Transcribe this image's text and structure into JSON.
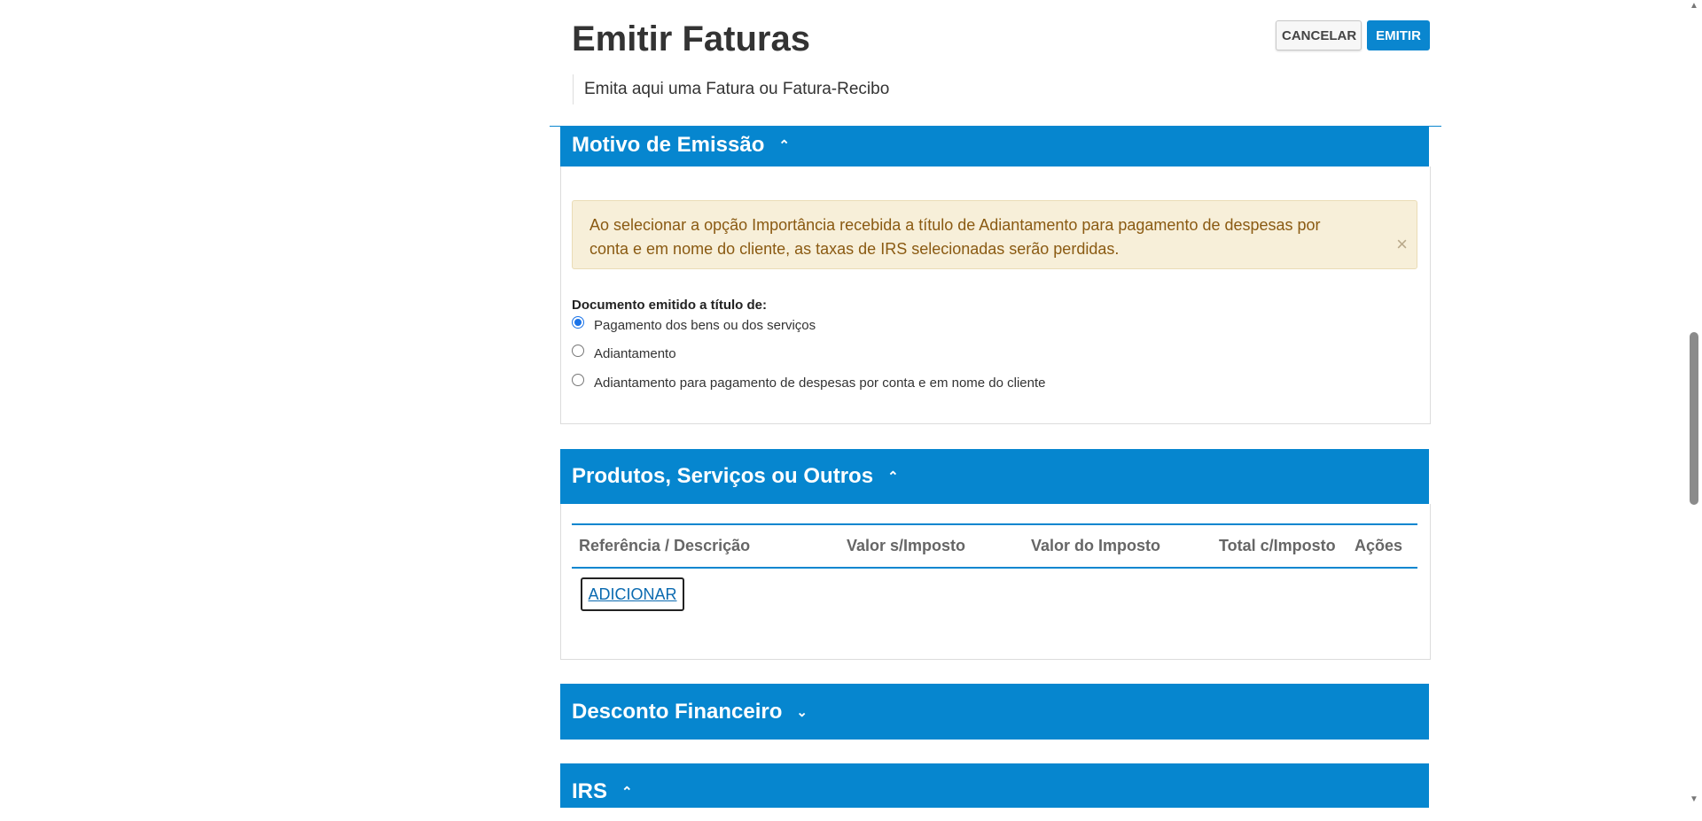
{
  "header": {
    "title": "Emitir Faturas",
    "subtitle": "Emita aqui uma Fatura ou Fatura-Recibo",
    "cancel_label": "CANCELAR",
    "emit_label": "EMITIR"
  },
  "motivo": {
    "title": "Motivo de Emissão",
    "alert_text": "Ao selecionar a opção Importância recebida a título de Adiantamento para pagamento de despesas por conta e em nome do cliente, as taxas de IRS selecionadas serão perdidas.",
    "alert_close": "×",
    "radio_group_label": "Documento emitido a título de:",
    "options": [
      {
        "label": "Pagamento dos bens ou dos serviços",
        "checked": true
      },
      {
        "label": "Adiantamento",
        "checked": false
      },
      {
        "label": "Adiantamento para pagamento de despesas por conta e em nome do cliente",
        "checked": false
      }
    ]
  },
  "produtos": {
    "title": "Produtos, Serviços ou Outros",
    "columns": [
      "Referência / Descrição",
      "Valor s/Imposto",
      "Valor do Imposto",
      "Total c/Imposto",
      "Ações"
    ],
    "add_label": "ADICIONAR"
  },
  "desconto": {
    "title": "Desconto Financeiro"
  },
  "irs": {
    "title": "IRS"
  },
  "icons": {
    "chevron_up": "⌃",
    "chevron_down": "⌄"
  },
  "colors": {
    "primary": "#0686cf",
    "alert_bg": "#f7efd9",
    "alert_text": "#8a5a12"
  }
}
